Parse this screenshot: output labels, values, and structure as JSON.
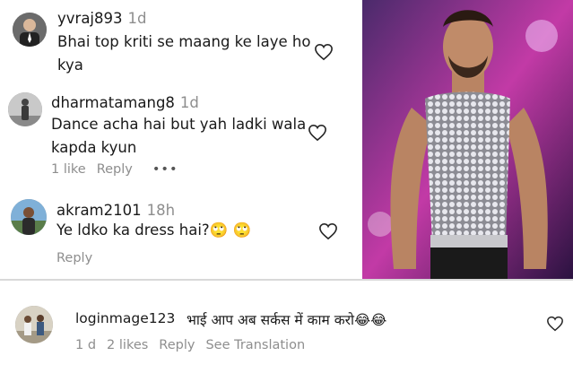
{
  "comments": [
    {
      "username": "yvraj893",
      "age": "1d",
      "text_lines": [
        "Bhai top kriti se maang ke laye ho",
        "kya"
      ],
      "avatar_icon": "suit-person-avatar"
    },
    {
      "username": "dharmatamang8",
      "age": "1d",
      "text_lines": [
        "Dance acha hai but yah ladki wala",
        "kapda kyun"
      ],
      "likes": "1 like",
      "reply_label": "Reply",
      "more_label": "•••",
      "avatar_icon": "standing-person-avatar"
    },
    {
      "username": "akram2101",
      "age": "18h",
      "text_lines": [
        "Ye ldko ka dress hai?🙄 🙄"
      ],
      "reply_label": "Reply",
      "avatar_icon": "outdoor-person-avatar"
    }
  ],
  "bottom_comment": {
    "username": "loginmage123",
    "text": "भाई आप अब सर्कस में काम करो😂😂",
    "age": "1 d",
    "likes": "2 likes",
    "reply_label": "Reply",
    "translation_label": "See Translation",
    "avatar_icon": "group-people-avatar"
  },
  "colors": {
    "text": "#1a1a1a",
    "meta": "#8e8e8e",
    "separator": "#d9d9d9",
    "photo_background": "#3a1d52"
  },
  "icons": {
    "like": "heart-outline-icon",
    "more": "more-options-icon",
    "photo": "dancer-sequin-top-photo"
  }
}
